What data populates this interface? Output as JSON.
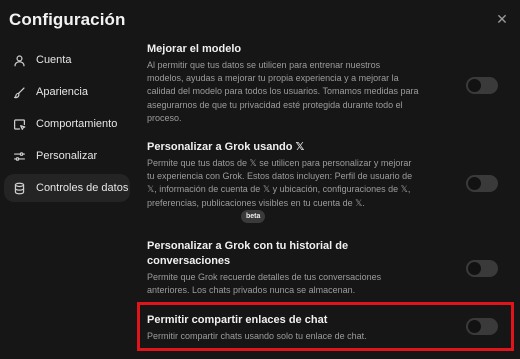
{
  "dialog": {
    "title": "Configuración",
    "close_glyph": "✕"
  },
  "sidebar": {
    "items": [
      {
        "label": "Cuenta",
        "icon": "user-icon",
        "active": false
      },
      {
        "label": "Apariencia",
        "icon": "brush-icon",
        "active": false
      },
      {
        "label": "Comportamiento",
        "icon": "cursor-window-icon",
        "active": false
      },
      {
        "label": "Personalizar",
        "icon": "sliders-icon",
        "active": false
      },
      {
        "label": "Controles de datos",
        "icon": "database-icon",
        "active": true
      }
    ]
  },
  "settings": [
    {
      "title": "Mejorar el modelo",
      "description": "Al permitir que tus datos se utilicen para entrenar nuestros modelos, ayudas a mejorar tu propia experiencia y a mejorar la calidad del modelo para todos los usuarios. Tomamos medidas para asegurarnos de que tu privacidad esté protegida durante todo el proceso.",
      "enabled": false
    },
    {
      "title": "Personalizar a Grok usando 𝕏",
      "description": "Permite que tus datos de 𝕏 se utilicen para personalizar y mejorar tu experiencia con Grok. Estos datos incluyen: Perfil de usuario de 𝕏, información de cuenta de 𝕏 y ubicación, configuraciones de 𝕏, preferencias, publicaciones visibles en tu cuenta de 𝕏.",
      "enabled": false
    },
    {
      "title": "Personalizar a Grok con tu historial de conversaciones",
      "badge": "beta",
      "description": "Permite que Grok recuerde detalles de tus conversaciones anteriores. Los chats privados nunca se almacenan.",
      "enabled": false
    },
    {
      "title": "Permitir compartir enlaces de chat",
      "description": "Permitir compartir chats usando solo tu enlace de chat.",
      "enabled": false
    }
  ],
  "colors": {
    "background": "#161616",
    "active_nav": "#242424",
    "toggle_off": "#3a3a3a",
    "highlight": "#e0141b"
  }
}
